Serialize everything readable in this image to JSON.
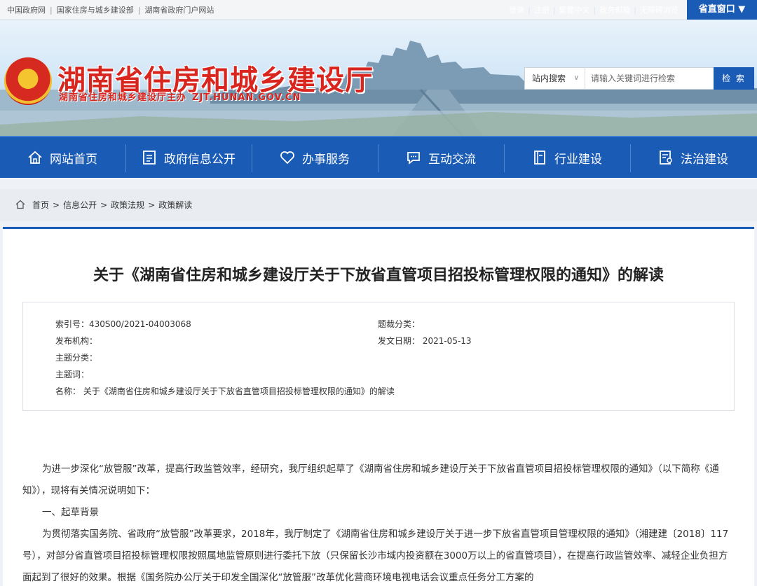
{
  "topbar": {
    "links": [
      "中国政府网",
      "国家住房与城乡建设部",
      "湖南省政府门户网站"
    ],
    "right_links": [
      "登录",
      "注册",
      "繁體中文",
      "政务邮箱",
      "无障碍浏览"
    ],
    "window_label": "省直窗口",
    "window_arrow": "▼"
  },
  "header": {
    "title": "湖南省住房和城乡建设厅",
    "subtitle": "湖南省住房和城乡建设厅主办",
    "url": "ZJT.HUNAN.GOV.CN"
  },
  "search": {
    "scope": "站内搜索",
    "scope_arrow": "∨",
    "placeholder": "请输入关键词进行检索",
    "button": "检 索"
  },
  "nav": {
    "items": [
      {
        "label": "网站首页",
        "icon": "home-icon"
      },
      {
        "label": "政府信息公开",
        "icon": "document-icon"
      },
      {
        "label": "办事服务",
        "icon": "heart-icon"
      },
      {
        "label": "互动交流",
        "icon": "chat-icon"
      },
      {
        "label": "行业建设",
        "icon": "book-icon"
      },
      {
        "label": "法治建设",
        "icon": "law-icon"
      }
    ]
  },
  "breadcrumb": {
    "items": [
      "首页",
      "信息公开",
      "政策法规",
      "政策解读"
    ],
    "sep": ">"
  },
  "article": {
    "title": "关于《湖南省住房和城乡建设厅关于下放省直管项目招投标管理权限的通知》的解读",
    "meta": {
      "index_no": "索引号：430S00/2021-04003068",
      "category": "题裁分类：",
      "publisher": "发布机构：",
      "date": "发文日期： 2021-05-13",
      "topic": "主题分类：",
      "keywords": "主题词：",
      "name": "名称： 关于《湖南省住房和城乡建设厅关于下放省直管项目招投标管理权限的通知》的解读"
    },
    "paragraphs": [
      "为进一步深化“放管服”改革，提高行政监管效率，经研究，我厅组织起草了《湖南省住房和城乡建设厅关于下放省直管项目招投标管理权限的通知》（以下简称《通知》），现将有关情况说明如下：",
      "一、起草背景",
      "为贯彻落实国务院、省政府“放管服”改革要求，2018年，我厅制定了《湖南省住房和城乡建设厅关于进一步下放省直管项目管理权限的通知》（湘建建〔2018〕117号），对部分省直管项目招投标管理权限按照属地监管原则进行委托下放（只保留长沙市域内投资额在3000万以上的省直管项目），在提高行政监管效率、减轻企业负担方面起到了很好的效果。根据《国务院办公厅关于印发全国深化“放管服”改革优化营商环境电视电话会议重点任务分工方案的"
    ]
  },
  "colors": {
    "brand_blue": "#1a5bb6",
    "title_red": "#d8261f"
  }
}
